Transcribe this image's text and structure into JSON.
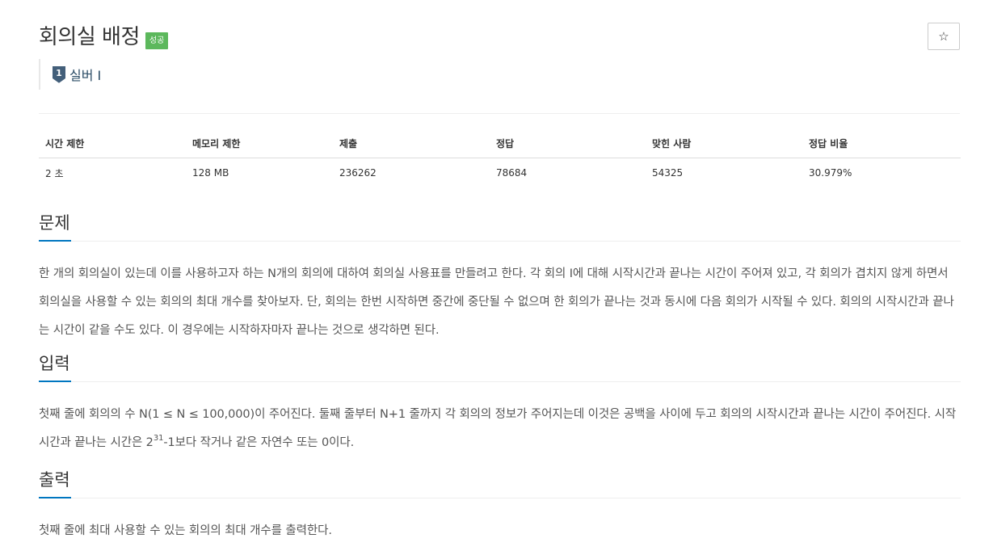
{
  "problem": {
    "title": "회의실 배정",
    "status_badge": "성공",
    "star_icon": "☆",
    "tier_icon": "silver-1-icon",
    "tier_icon_number": "1",
    "tier_label": "실버 I"
  },
  "colors": {
    "badge": "#5cb85c",
    "section_accent": "#0076c0",
    "tier_icon": "#435f7a"
  },
  "stats": {
    "headers": [
      "시간 제한",
      "메모리 제한",
      "제출",
      "정답",
      "맞힌 사람",
      "정답 비율"
    ],
    "values": [
      "2 초",
      "128 MB",
      "236262",
      "78684",
      "54325",
      "30.979%"
    ]
  },
  "sections": {
    "problem": {
      "title": "문제",
      "text": "한 개의 회의실이 있는데 이를 사용하고자 하는 N개의 회의에 대하여 회의실 사용표를 만들려고 한다. 각 회의 I에 대해 시작시간과 끝나는 시간이 주어져 있고, 각 회의가 겹치지 않게 하면서 회의실을 사용할 수 있는 회의의 최대 개수를 찾아보자. 단, 회의는 한번 시작하면 중간에 중단될 수 없으며 한 회의가 끝나는 것과 동시에 다음 회의가 시작될 수 있다. 회의의 시작시간과 끝나는 시간이 같을 수도 있다. 이 경우에는 시작하자마자 끝나는 것으로 생각하면 된다."
    },
    "input": {
      "title": "입력",
      "text_before": "첫째 줄에 회의의 수 N(1 ≤ N ≤ 100,000)이 주어진다. 둘째 줄부터 N+1 줄까지 각 회의의 정보가 주어지는데 이것은 공백을 사이에 두고 회의의 시작시간과 끝나는 시간이 주어진다. 시작 시간과 끝나는 시간은 2",
      "exponent": "31",
      "text_after": "-1보다 작거나 같은 자연수 또는 0이다."
    },
    "output": {
      "title": "출력",
      "text": "첫째 줄에 최대 사용할 수 있는 회의의 최대 개수를 출력한다."
    }
  }
}
